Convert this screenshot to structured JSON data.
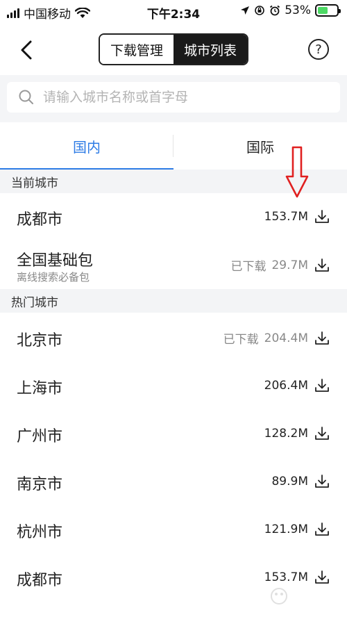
{
  "status_bar": {
    "carrier": "中国移动",
    "time": "下午2:34",
    "battery": "53%",
    "battery_level": 0.53
  },
  "nav": {
    "segments": [
      {
        "label": "下载管理",
        "active": false
      },
      {
        "label": "城市列表",
        "active": true
      }
    ],
    "help_label": "?"
  },
  "search": {
    "placeholder": "请输入城市名称或首字母"
  },
  "tabs": [
    {
      "label": "国内",
      "active": true
    },
    {
      "label": "国际",
      "active": false
    }
  ],
  "sections": {
    "current": "当前城市",
    "hot": "热门城市"
  },
  "current_cities": [
    {
      "name": "成都市",
      "status": "",
      "size": "153.7M"
    },
    {
      "name": "全国基础包",
      "subtitle": "离线搜索必备包",
      "status": "已下载",
      "size": "29.7M"
    }
  ],
  "hot_cities": [
    {
      "name": "北京市",
      "status": "已下载",
      "size": "204.4M"
    },
    {
      "name": "上海市",
      "status": "",
      "size": "206.4M"
    },
    {
      "name": "广州市",
      "status": "",
      "size": "128.2M"
    },
    {
      "name": "南京市",
      "status": "",
      "size": "89.9M"
    },
    {
      "name": "杭州市",
      "status": "",
      "size": "121.9M"
    },
    {
      "name": "成都市",
      "status": "",
      "size": "153.7M"
    }
  ],
  "colors": {
    "accent": "#2d7be5",
    "annotation": "#e02020",
    "section_bg": "#f3f4f6"
  },
  "icons": [
    "back-chevron-icon",
    "help-icon",
    "search-icon",
    "download-icon",
    "wifi-icon",
    "signal-icon",
    "battery-icon"
  ]
}
